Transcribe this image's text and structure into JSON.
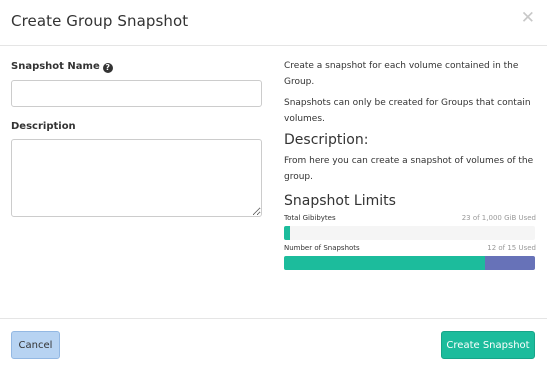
{
  "dialog": {
    "title": "Create Group Snapshot",
    "close_glyph": "✕"
  },
  "form": {
    "snapshot_name_label": "Snapshot Name",
    "help_icon_glyph": "?",
    "snapshot_name_value": "",
    "description_label": "Description",
    "description_value": ""
  },
  "help": {
    "para1": "Create a snapshot for each volume contained in the Group.",
    "para2": "Snapshots can only be created for Groups that contain volumes.",
    "description_heading": "Description:",
    "description_text": "From here you can create a snapshot of volumes of the group.",
    "limits_heading": "Snapshot Limits"
  },
  "limits": [
    {
      "label": "Total Gibibytes",
      "used_text": "23 of 1,000 GiB Used",
      "used_fraction": 0.023,
      "added_fraction": 0.0
    },
    {
      "label": "Number of Snapshots",
      "used_text": "12 of 15 Used",
      "used_fraction": 0.8,
      "added_fraction": 0.2
    }
  ],
  "footer": {
    "cancel_label": "Cancel",
    "create_label": "Create Snapshot"
  },
  "colors": {
    "primary": "#1cbc9c",
    "added": "#6772b8",
    "cancel_bg": "#b7d3f2"
  }
}
